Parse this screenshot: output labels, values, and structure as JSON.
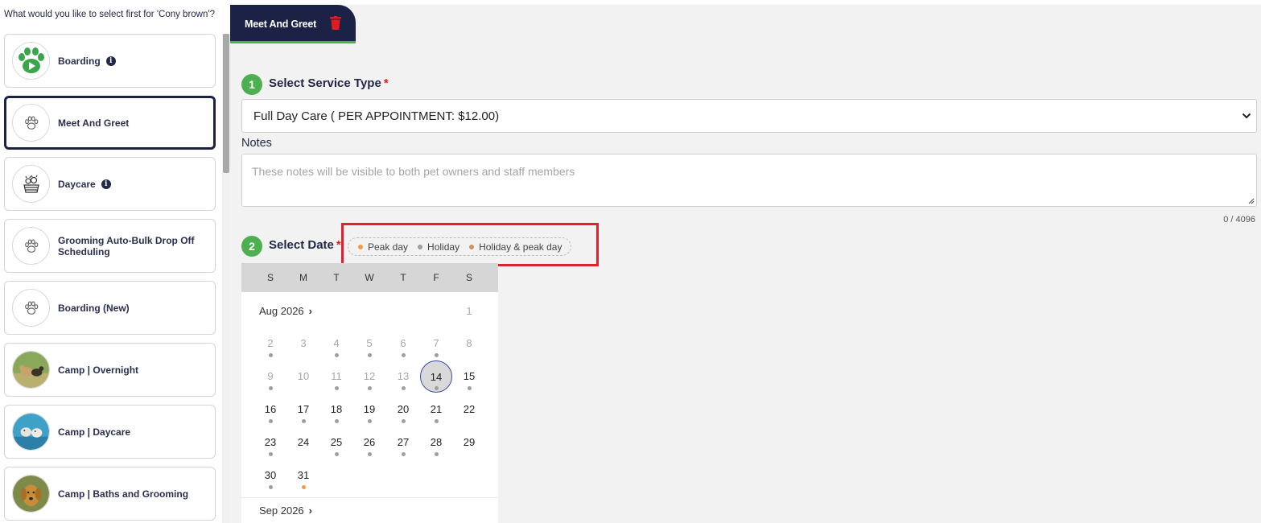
{
  "left_panel": {
    "question": "What would you like to select first for 'Cony brown'?",
    "services": [
      {
        "label": "Boarding",
        "icon": "paw-play-icon",
        "info": true,
        "selected": false
      },
      {
        "label": "Meet And Greet",
        "icon": "paw-icon",
        "info": false,
        "selected": true
      },
      {
        "label": "Daycare",
        "icon": "dog-basket-icon",
        "info": true,
        "selected": false
      },
      {
        "label": "Grooming Auto-Bulk Drop Off Scheduling",
        "icon": "paw-icon",
        "info": false,
        "selected": false
      },
      {
        "label": "Boarding (New)",
        "icon": "paw-icon",
        "info": false,
        "selected": false
      },
      {
        "label": "Camp | Overnight",
        "icon": "dogs-photo",
        "info": false,
        "selected": false
      },
      {
        "label": "Camp | Daycare",
        "icon": "dogs-pool-photo",
        "info": false,
        "selected": false
      },
      {
        "label": "Camp | Baths and Grooming",
        "icon": "golden-retriever-photo",
        "info": false,
        "selected": false
      }
    ]
  },
  "tab": {
    "label": "Meet And Greet",
    "delete_icon": "trash-icon"
  },
  "step1": {
    "number": "1",
    "title": "Select Service Type",
    "required": "*"
  },
  "service_select": {
    "value": "Full Day Care ( PER APPOINTMENT: $12.00)"
  },
  "notes": {
    "label": "Notes",
    "placeholder": "These notes will be visible to both pet owners and staff members",
    "counter": "0 / 4096"
  },
  "step2": {
    "number": "2",
    "title": "Select Date",
    "required": "*"
  },
  "legend": [
    {
      "label": "Peak day",
      "color": "#f2994a"
    },
    {
      "label": "Holiday",
      "color": "#9e9e9e"
    },
    {
      "label": "Holiday & peak day",
      "color": "#c8946a"
    }
  ],
  "calendar": {
    "weekdays": [
      "S",
      "M",
      "T",
      "W",
      "T",
      "F",
      "S"
    ],
    "months": [
      "Aug 2026",
      "Sep 2026"
    ],
    "today": "14",
    "days": [
      {
        "d": "1",
        "col": 6,
        "row": 0,
        "muted": true,
        "dot": null
      },
      {
        "d": "2",
        "col": 0,
        "row": 1,
        "muted": true,
        "dot": "holiday"
      },
      {
        "d": "3",
        "col": 1,
        "row": 1,
        "muted": true,
        "dot": null
      },
      {
        "d": "4",
        "col": 2,
        "row": 1,
        "muted": true,
        "dot": "holiday"
      },
      {
        "d": "5",
        "col": 3,
        "row": 1,
        "muted": true,
        "dot": "holiday"
      },
      {
        "d": "6",
        "col": 4,
        "row": 1,
        "muted": true,
        "dot": "holiday"
      },
      {
        "d": "7",
        "col": 5,
        "row": 1,
        "muted": true,
        "dot": "holiday"
      },
      {
        "d": "8",
        "col": 6,
        "row": 1,
        "muted": true,
        "dot": null
      },
      {
        "d": "9",
        "col": 0,
        "row": 2,
        "muted": true,
        "dot": "holiday"
      },
      {
        "d": "10",
        "col": 1,
        "row": 2,
        "muted": true,
        "dot": null
      },
      {
        "d": "11",
        "col": 2,
        "row": 2,
        "muted": true,
        "dot": "holiday"
      },
      {
        "d": "12",
        "col": 3,
        "row": 2,
        "muted": true,
        "dot": "holiday"
      },
      {
        "d": "13",
        "col": 4,
        "row": 2,
        "muted": true,
        "dot": "holiday"
      },
      {
        "d": "14",
        "col": 5,
        "row": 2,
        "muted": false,
        "dot": "holiday",
        "today": true
      },
      {
        "d": "15",
        "col": 6,
        "row": 2,
        "muted": false,
        "dot": "holiday"
      },
      {
        "d": "16",
        "col": 0,
        "row": 3,
        "muted": false,
        "dot": "holiday"
      },
      {
        "d": "17",
        "col": 1,
        "row": 3,
        "muted": false,
        "dot": "holiday"
      },
      {
        "d": "18",
        "col": 2,
        "row": 3,
        "muted": false,
        "dot": "holiday"
      },
      {
        "d": "19",
        "col": 3,
        "row": 3,
        "muted": false,
        "dot": "holiday"
      },
      {
        "d": "20",
        "col": 4,
        "row": 3,
        "muted": false,
        "dot": "holiday"
      },
      {
        "d": "21",
        "col": 5,
        "row": 3,
        "muted": false,
        "dot": "holiday"
      },
      {
        "d": "22",
        "col": 6,
        "row": 3,
        "muted": false,
        "dot": null
      },
      {
        "d": "23",
        "col": 0,
        "row": 4,
        "muted": false,
        "dot": "holiday"
      },
      {
        "d": "24",
        "col": 1,
        "row": 4,
        "muted": false,
        "dot": null
      },
      {
        "d": "25",
        "col": 2,
        "row": 4,
        "muted": false,
        "dot": "holiday"
      },
      {
        "d": "26",
        "col": 3,
        "row": 4,
        "muted": false,
        "dot": "holiday"
      },
      {
        "d": "27",
        "col": 4,
        "row": 4,
        "muted": false,
        "dot": "holiday"
      },
      {
        "d": "28",
        "col": 5,
        "row": 4,
        "muted": false,
        "dot": "holiday"
      },
      {
        "d": "29",
        "col": 6,
        "row": 4,
        "muted": false,
        "dot": null
      },
      {
        "d": "30",
        "col": 0,
        "row": 5,
        "muted": false,
        "dot": "holiday"
      },
      {
        "d": "31",
        "col": 1,
        "row": 5,
        "muted": false,
        "dot": "peak"
      }
    ]
  },
  "colors": {
    "navy": "#1c2146",
    "green": "#4caf50",
    "required": "#e02020",
    "highlight": "#e0202a",
    "peak": "#f2994a",
    "holiday": "#9e9e9e"
  }
}
